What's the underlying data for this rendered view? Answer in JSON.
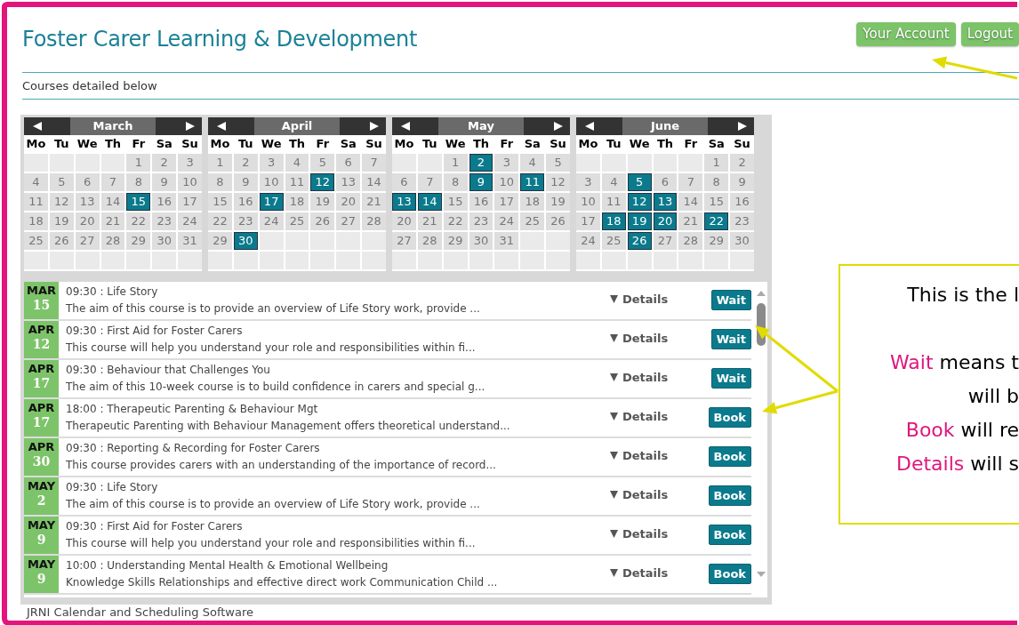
{
  "header": {
    "title": "Foster Carer Learning & Development",
    "buttons": [
      "Your Account",
      "Logout"
    ]
  },
  "subtitle": "Courses detailed below",
  "months": [
    {
      "name": "March",
      "weekdays": [
        "Mo",
        "Tu",
        "We",
        "Th",
        "Fr",
        "Sa",
        "Su"
      ],
      "weeks": [
        [
          {
            "kind": "blank"
          },
          {
            "kind": "blank"
          },
          {
            "kind": "blank"
          },
          {
            "kind": "blank"
          },
          {
            "kind": "day",
            "d": "1",
            "marked": false
          },
          {
            "kind": "day",
            "d": "2",
            "marked": false
          },
          {
            "kind": "day",
            "d": "3",
            "marked": false
          }
        ],
        [
          {
            "kind": "day",
            "d": "4",
            "marked": false
          },
          {
            "kind": "day",
            "d": "5",
            "marked": false
          },
          {
            "kind": "day",
            "d": "6",
            "marked": false
          },
          {
            "kind": "day",
            "d": "7",
            "marked": false
          },
          {
            "kind": "day",
            "d": "8",
            "marked": false
          },
          {
            "kind": "day",
            "d": "9",
            "marked": false
          },
          {
            "kind": "day",
            "d": "10",
            "marked": false
          }
        ],
        [
          {
            "kind": "day",
            "d": "11",
            "marked": false
          },
          {
            "kind": "day",
            "d": "12",
            "marked": false
          },
          {
            "kind": "day",
            "d": "13",
            "marked": false
          },
          {
            "kind": "day",
            "d": "14",
            "marked": false
          },
          {
            "kind": "day",
            "d": "15",
            "marked": true
          },
          {
            "kind": "day",
            "d": "16",
            "marked": false
          },
          {
            "kind": "day",
            "d": "17",
            "marked": false
          }
        ],
        [
          {
            "kind": "day",
            "d": "18",
            "marked": false
          },
          {
            "kind": "day",
            "d": "19",
            "marked": false
          },
          {
            "kind": "day",
            "d": "20",
            "marked": false
          },
          {
            "kind": "day",
            "d": "21",
            "marked": false
          },
          {
            "kind": "day",
            "d": "22",
            "marked": false
          },
          {
            "kind": "day",
            "d": "23",
            "marked": false
          },
          {
            "kind": "day",
            "d": "24",
            "marked": false
          }
        ],
        [
          {
            "kind": "day",
            "d": "25",
            "marked": false
          },
          {
            "kind": "day",
            "d": "26",
            "marked": false
          },
          {
            "kind": "day",
            "d": "27",
            "marked": false
          },
          {
            "kind": "day",
            "d": "28",
            "marked": false
          },
          {
            "kind": "day",
            "d": "29",
            "marked": false
          },
          {
            "kind": "day",
            "d": "30",
            "marked": false
          },
          {
            "kind": "day",
            "d": "31",
            "marked": false
          }
        ],
        [
          {
            "kind": "blank"
          },
          {
            "kind": "blank"
          },
          {
            "kind": "blank"
          },
          {
            "kind": "blank"
          },
          {
            "kind": "blank"
          },
          {
            "kind": "blank"
          },
          {
            "kind": "blank"
          }
        ]
      ]
    },
    {
      "name": "April",
      "weekdays": [
        "Mo",
        "Tu",
        "We",
        "Th",
        "Fr",
        "Sa",
        "Su"
      ],
      "weeks": [
        [
          {
            "kind": "day",
            "d": "1",
            "marked": false
          },
          {
            "kind": "day",
            "d": "2",
            "marked": false
          },
          {
            "kind": "day",
            "d": "3",
            "marked": false
          },
          {
            "kind": "day",
            "d": "4",
            "marked": false
          },
          {
            "kind": "day",
            "d": "5",
            "marked": false
          },
          {
            "kind": "day",
            "d": "6",
            "marked": false
          },
          {
            "kind": "day",
            "d": "7",
            "marked": false
          }
        ],
        [
          {
            "kind": "day",
            "d": "8",
            "marked": false
          },
          {
            "kind": "day",
            "d": "9",
            "marked": false
          },
          {
            "kind": "day",
            "d": "10",
            "marked": false
          },
          {
            "kind": "day",
            "d": "11",
            "marked": false
          },
          {
            "kind": "day",
            "d": "12",
            "marked": true
          },
          {
            "kind": "day",
            "d": "13",
            "marked": false
          },
          {
            "kind": "day",
            "d": "14",
            "marked": false
          }
        ],
        [
          {
            "kind": "day",
            "d": "15",
            "marked": false
          },
          {
            "kind": "day",
            "d": "16",
            "marked": false
          },
          {
            "kind": "day",
            "d": "17",
            "marked": true
          },
          {
            "kind": "day",
            "d": "18",
            "marked": false
          },
          {
            "kind": "day",
            "d": "19",
            "marked": false
          },
          {
            "kind": "day",
            "d": "20",
            "marked": false
          },
          {
            "kind": "day",
            "d": "21",
            "marked": false
          }
        ],
        [
          {
            "kind": "day",
            "d": "22",
            "marked": false
          },
          {
            "kind": "day",
            "d": "23",
            "marked": false
          },
          {
            "kind": "day",
            "d": "24",
            "marked": false
          },
          {
            "kind": "day",
            "d": "25",
            "marked": false
          },
          {
            "kind": "day",
            "d": "26",
            "marked": false
          },
          {
            "kind": "day",
            "d": "27",
            "marked": false
          },
          {
            "kind": "day",
            "d": "28",
            "marked": false
          }
        ],
        [
          {
            "kind": "day",
            "d": "29",
            "marked": false
          },
          {
            "kind": "day",
            "d": "30",
            "marked": true
          },
          {
            "kind": "blank"
          },
          {
            "kind": "blank"
          },
          {
            "kind": "blank"
          },
          {
            "kind": "blank"
          },
          {
            "kind": "blank"
          }
        ],
        [
          {
            "kind": "blank"
          },
          {
            "kind": "blank"
          },
          {
            "kind": "blank"
          },
          {
            "kind": "blank"
          },
          {
            "kind": "blank"
          },
          {
            "kind": "blank"
          },
          {
            "kind": "blank"
          }
        ]
      ]
    },
    {
      "name": "May",
      "weekdays": [
        "Mo",
        "Tu",
        "We",
        "Th",
        "Fr",
        "Sa",
        "Su"
      ],
      "weeks": [
        [
          {
            "kind": "blank"
          },
          {
            "kind": "blank"
          },
          {
            "kind": "day",
            "d": "1",
            "marked": false
          },
          {
            "kind": "day",
            "d": "2",
            "marked": true
          },
          {
            "kind": "day",
            "d": "3",
            "marked": false
          },
          {
            "kind": "day",
            "d": "4",
            "marked": false
          },
          {
            "kind": "day",
            "d": "5",
            "marked": false
          }
        ],
        [
          {
            "kind": "day",
            "d": "6",
            "marked": false
          },
          {
            "kind": "day",
            "d": "7",
            "marked": false
          },
          {
            "kind": "day",
            "d": "8",
            "marked": false
          },
          {
            "kind": "day",
            "d": "9",
            "marked": true
          },
          {
            "kind": "day",
            "d": "10",
            "marked": false
          },
          {
            "kind": "day",
            "d": "11",
            "marked": true
          },
          {
            "kind": "day",
            "d": "12",
            "marked": false
          }
        ],
        [
          {
            "kind": "day",
            "d": "13",
            "marked": true
          },
          {
            "kind": "day",
            "d": "14",
            "marked": true
          },
          {
            "kind": "day",
            "d": "15",
            "marked": false
          },
          {
            "kind": "day",
            "d": "16",
            "marked": false
          },
          {
            "kind": "day",
            "d": "17",
            "marked": false
          },
          {
            "kind": "day",
            "d": "18",
            "marked": false
          },
          {
            "kind": "day",
            "d": "19",
            "marked": false
          }
        ],
        [
          {
            "kind": "day",
            "d": "20",
            "marked": false
          },
          {
            "kind": "day",
            "d": "21",
            "marked": false
          },
          {
            "kind": "day",
            "d": "22",
            "marked": false
          },
          {
            "kind": "day",
            "d": "23",
            "marked": false
          },
          {
            "kind": "day",
            "d": "24",
            "marked": false
          },
          {
            "kind": "day",
            "d": "25",
            "marked": false
          },
          {
            "kind": "day",
            "d": "26",
            "marked": false
          }
        ],
        [
          {
            "kind": "day",
            "d": "27",
            "marked": false
          },
          {
            "kind": "day",
            "d": "28",
            "marked": false
          },
          {
            "kind": "day",
            "d": "29",
            "marked": false
          },
          {
            "kind": "day",
            "d": "30",
            "marked": false
          },
          {
            "kind": "day",
            "d": "31",
            "marked": false
          },
          {
            "kind": "blank"
          },
          {
            "kind": "blank"
          }
        ],
        [
          {
            "kind": "blank"
          },
          {
            "kind": "blank"
          },
          {
            "kind": "blank"
          },
          {
            "kind": "blank"
          },
          {
            "kind": "blank"
          },
          {
            "kind": "blank"
          },
          {
            "kind": "blank"
          }
        ]
      ]
    },
    {
      "name": "June",
      "weekdays": [
        "Mo",
        "Tu",
        "We",
        "Th",
        "Fr",
        "Sa",
        "Su"
      ],
      "weeks": [
        [
          {
            "kind": "blank"
          },
          {
            "kind": "blank"
          },
          {
            "kind": "blank"
          },
          {
            "kind": "blank"
          },
          {
            "kind": "blank"
          },
          {
            "kind": "day",
            "d": "1",
            "marked": false
          },
          {
            "kind": "day",
            "d": "2",
            "marked": false
          }
        ],
        [
          {
            "kind": "day",
            "d": "3",
            "marked": false
          },
          {
            "kind": "day",
            "d": "4",
            "marked": false
          },
          {
            "kind": "day",
            "d": "5",
            "marked": true
          },
          {
            "kind": "day",
            "d": "6",
            "marked": false
          },
          {
            "kind": "day",
            "d": "7",
            "marked": false
          },
          {
            "kind": "day",
            "d": "8",
            "marked": false
          },
          {
            "kind": "day",
            "d": "9",
            "marked": false
          }
        ],
        [
          {
            "kind": "day",
            "d": "10",
            "marked": false
          },
          {
            "kind": "day",
            "d": "11",
            "marked": false
          },
          {
            "kind": "day",
            "d": "12",
            "marked": true
          },
          {
            "kind": "day",
            "d": "13",
            "marked": true
          },
          {
            "kind": "day",
            "d": "14",
            "marked": false
          },
          {
            "kind": "day",
            "d": "15",
            "marked": false
          },
          {
            "kind": "day",
            "d": "16",
            "marked": false
          }
        ],
        [
          {
            "kind": "day",
            "d": "17",
            "marked": false
          },
          {
            "kind": "day",
            "d": "18",
            "marked": true
          },
          {
            "kind": "day",
            "d": "19",
            "marked": true
          },
          {
            "kind": "day",
            "d": "20",
            "marked": true
          },
          {
            "kind": "day",
            "d": "21",
            "marked": false
          },
          {
            "kind": "day",
            "d": "22",
            "marked": true
          },
          {
            "kind": "day",
            "d": "23",
            "marked": false
          }
        ],
        [
          {
            "kind": "day",
            "d": "24",
            "marked": false
          },
          {
            "kind": "day",
            "d": "25",
            "marked": false
          },
          {
            "kind": "day",
            "d": "26",
            "marked": true
          },
          {
            "kind": "day",
            "d": "27",
            "marked": false
          },
          {
            "kind": "day",
            "d": "28",
            "marked": false
          },
          {
            "kind": "day",
            "d": "29",
            "marked": false
          },
          {
            "kind": "day",
            "d": "30",
            "marked": false
          }
        ],
        [
          {
            "kind": "blank"
          },
          {
            "kind": "blank"
          },
          {
            "kind": "blank"
          },
          {
            "kind": "blank"
          },
          {
            "kind": "blank"
          },
          {
            "kind": "blank"
          },
          {
            "kind": "blank"
          }
        ]
      ]
    }
  ],
  "courses": [
    {
      "month": "MAR",
      "day": "15",
      "title": "09:30 : Life Story",
      "description": "The aim of this course is to provide an overview of Life Story work, provide ...",
      "details": "Details",
      "action": "Wait"
    },
    {
      "month": "APR",
      "day": "12",
      "title": "09:30 : First Aid for Foster Carers",
      "description": "This course will help you understand your role and responsibilities within fi...",
      "details": "Details",
      "action": "Wait"
    },
    {
      "month": "APR",
      "day": "17",
      "title": "09:30 : Behaviour that Challenges You",
      "description": "The aim of this 10-week course is to build confidence in carers and special g...",
      "details": "Details",
      "action": "Wait"
    },
    {
      "month": "APR",
      "day": "17",
      "title": "18:00 : Therapeutic Parenting & Behaviour Mgt",
      "description": "Therapeutic Parenting with Behaviour Management offers theoretical understand...",
      "details": "Details",
      "action": "Book"
    },
    {
      "month": "APR",
      "day": "30",
      "title": "09:30 : Reporting & Recording for Foster Carers",
      "description": "This course provides carers with an understanding of the importance of record...",
      "details": "Details",
      "action": "Book"
    },
    {
      "month": "MAY",
      "day": "2",
      "title": "09:30 : Life Story",
      "description": "The aim of this course is to provide an overview of Life Story work, provide ...",
      "details": "Details",
      "action": "Book"
    },
    {
      "month": "MAY",
      "day": "9",
      "title": "09:30 : First Aid for Foster Carers",
      "description": "This course will help you understand your role and responsibilities within fi...",
      "details": "Details",
      "action": "Book"
    },
    {
      "month": "MAY",
      "day": "9",
      "title": "10:00 : Understanding Mental Health & Emotional Wellbeing",
      "description": "Knowledge Skills Relationships and effective direct work Communication Child ...",
      "details": "Details",
      "action": "Book"
    }
  ],
  "footer": "JRNI Calendar and Scheduling Software",
  "callout": {
    "lines": [
      {
        "text": "This is the l"
      },
      {
        "keyword": "Wait",
        "text": " means t"
      },
      {
        "text": "will b"
      },
      {
        "keyword": "Book",
        "text": " will re"
      },
      {
        "keyword": "Details",
        "text": " will s"
      }
    ]
  }
}
